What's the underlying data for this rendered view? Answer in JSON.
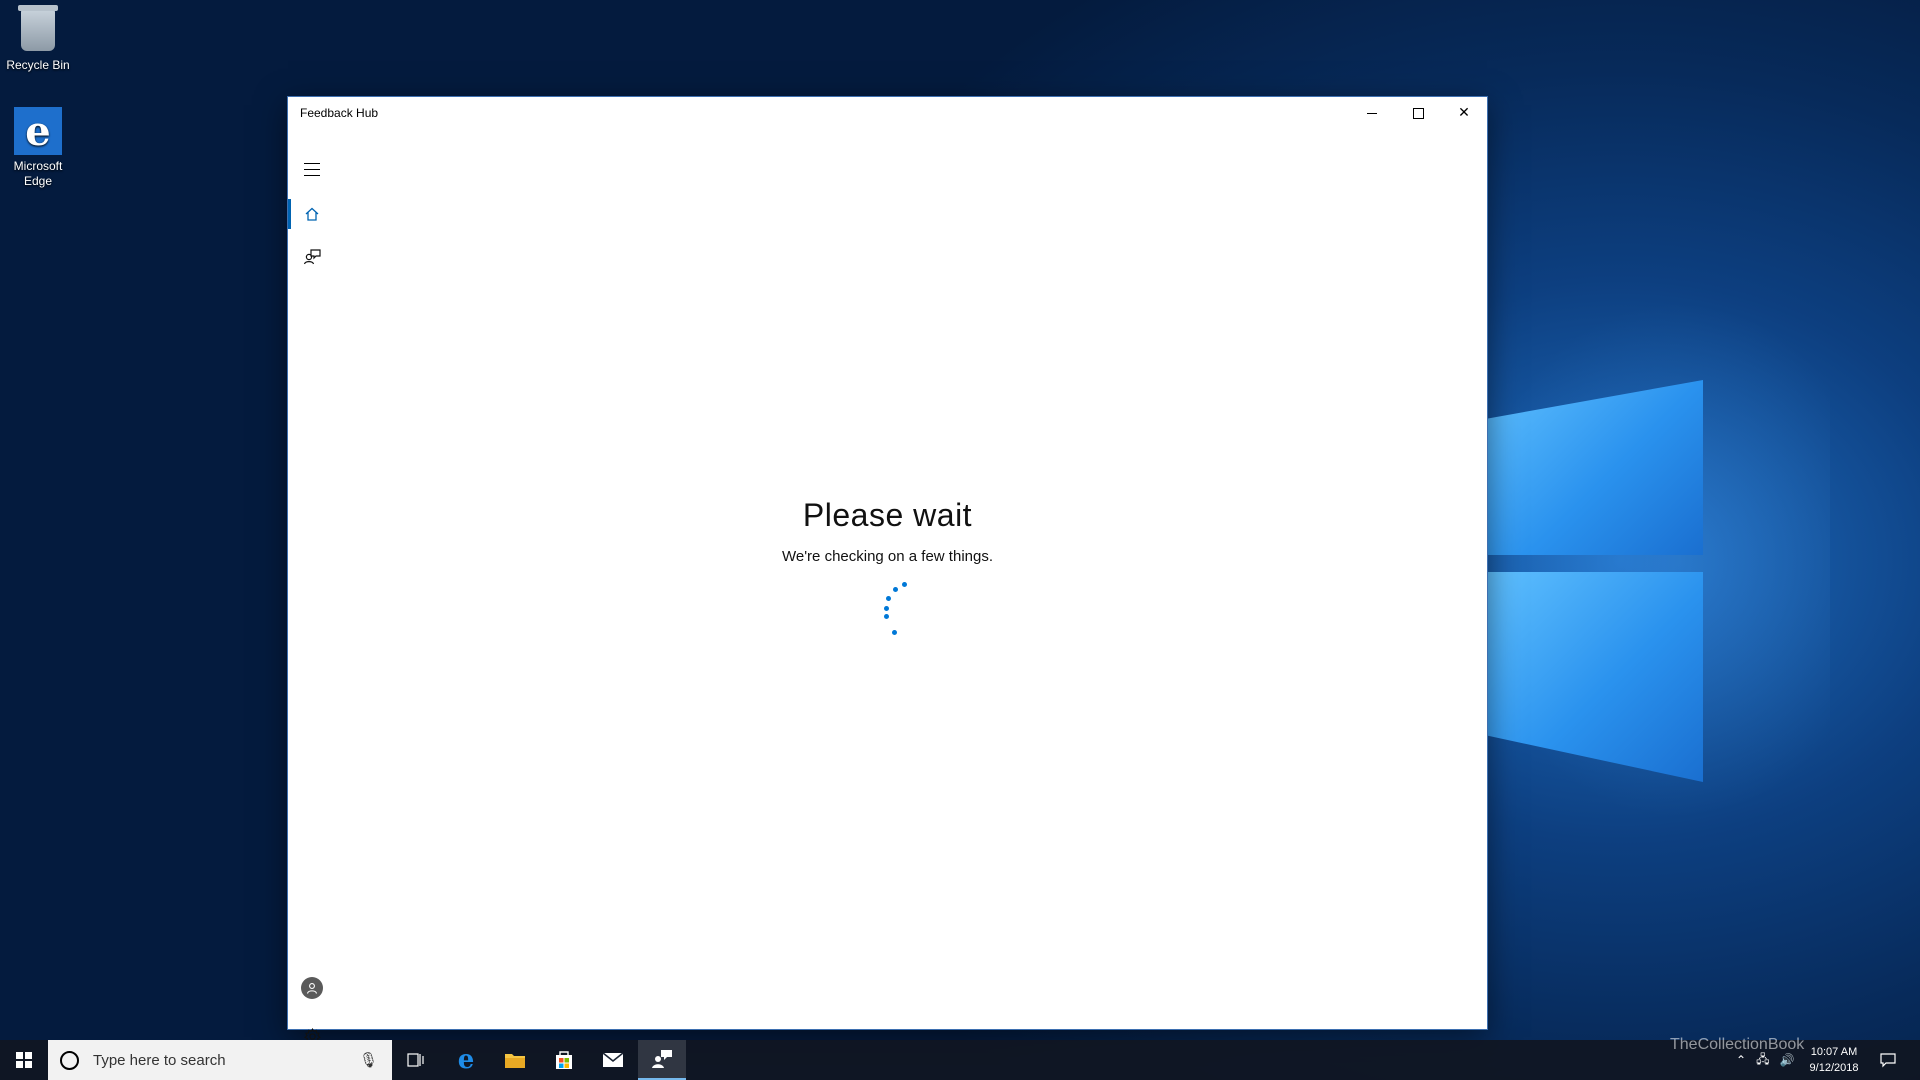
{
  "desktop": {
    "icons": [
      {
        "label": "Recycle Bin",
        "icon": "recycle-bin-icon"
      },
      {
        "label": "Microsoft Edge",
        "icon": "edge-icon"
      }
    ]
  },
  "window": {
    "title": "Feedback Hub",
    "controls": {
      "minimize": "minimize-icon",
      "maximize": "maximize-icon",
      "close": "close-icon"
    },
    "nav": {
      "items": [
        {
          "icon": "hamburger-menu-icon"
        },
        {
          "icon": "home-icon",
          "active": true
        },
        {
          "icon": "feedback-icon"
        }
      ],
      "bottom": [
        {
          "icon": "account-icon"
        },
        {
          "icon": "settings-gear-icon"
        }
      ]
    },
    "content": {
      "title": "Please wait",
      "subtitle": "We're checking on a few things."
    }
  },
  "taskbar": {
    "search_placeholder": "Type here to search",
    "apps": [
      "task-view-icon",
      "edge-icon",
      "file-explorer-icon",
      "store-icon",
      "mail-icon",
      "feedback-hub-icon"
    ],
    "active_app": "feedback-hub-icon",
    "clock": {
      "time": "10:07 AM",
      "date": "9/12/2018"
    }
  },
  "watermark": "TheCollectionBook",
  "colors": {
    "accent": "#0078d7",
    "nav_active": "#0063b1",
    "taskbar": "#101622"
  }
}
